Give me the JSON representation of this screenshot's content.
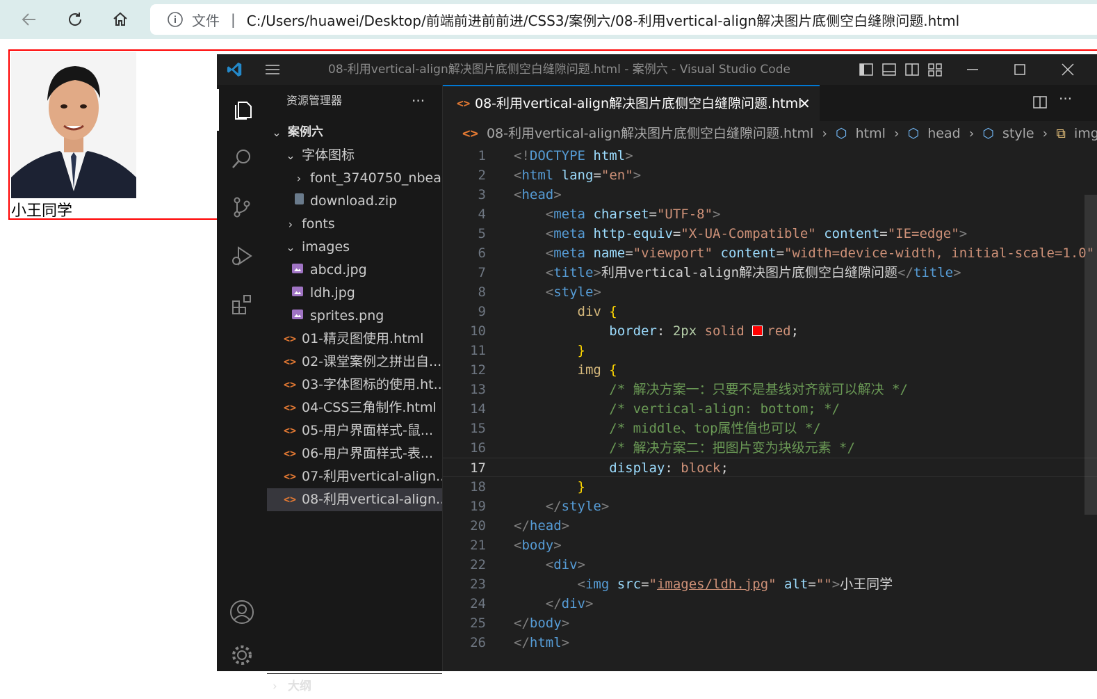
{
  "browser": {
    "file_label": "文件",
    "separator": "|",
    "url": "C:/Users/huawei/Desktop/前端前进前前进/CSS3/案例六/08-利用vertical-align解决图片底侧空白缝隙问题.html"
  },
  "page": {
    "caption": "小王同学",
    "border_color": "#ff0000"
  },
  "vscode": {
    "window_title": "08-利用vertical-align解决图片底侧空白缝隙问题.html - 案例六 - Visual Studio Code",
    "explorer": {
      "title": "资源管理器",
      "more": "···",
      "root": "案例六",
      "items": [
        {
          "label": "字体图标"
        },
        {
          "label": "font_3740750_nbea..."
        },
        {
          "label": "download.zip"
        },
        {
          "label": "fonts"
        },
        {
          "label": "images"
        },
        {
          "label": "abcd.jpg"
        },
        {
          "label": "ldh.jpg"
        },
        {
          "label": "sprites.png"
        },
        {
          "label": "01-精灵图使用.html"
        },
        {
          "label": "02-课堂案例之拼出自..."
        },
        {
          "label": "03-字体图标的使用.ht..."
        },
        {
          "label": "04-CSS三角制作.html"
        },
        {
          "label": "05-用户界面样式-鼠..."
        },
        {
          "label": "06-用户界面样式-表..."
        },
        {
          "label": "07-利用vertical-align..."
        },
        {
          "label": "08-利用vertical-align..."
        }
      ],
      "outline": "大纲"
    },
    "tab": {
      "label": "08-利用vertical-align解决图片底侧空白缝隙问题.html",
      "close": "✕"
    },
    "breadcrumb": {
      "file": "08-利用vertical-align解决图片底侧空白缝隙问题.html",
      "html": "html",
      "head": "head",
      "style": "style",
      "img": "img"
    },
    "code": {
      "line_numbers": [
        "1",
        "2",
        "3",
        "4",
        "5",
        "6",
        "7",
        "8",
        "9",
        "10",
        "11",
        "12",
        "13",
        "14",
        "15",
        "16",
        "17",
        "18",
        "19",
        "20",
        "21",
        "22",
        "23",
        "24",
        "25",
        "26"
      ],
      "current_line": "17",
      "lines": {
        "l1_tag": "DOCTYPE",
        "l1_attr": "html",
        "l2_tag": "html",
        "l2_attr": "lang",
        "l2_val": "\"en\"",
        "l3_tag": "head",
        "l4_tag": "meta",
        "l4_attr": "charset",
        "l4_val": "\"UTF-8\"",
        "l5_tag": "meta",
        "l5_attr1": "http-equiv",
        "l5_val1": "\"X-UA-Compatible\"",
        "l5_attr2": "content",
        "l5_val2": "\"IE=edge\"",
        "l6_tag": "meta",
        "l6_attr1": "name",
        "l6_val1": "\"viewport\"",
        "l6_attr2": "content",
        "l6_val2": "\"width=device-width, initial-scale=1.0\"",
        "l7_tag": "title",
        "l7_text": "利用vertical-align解决图片底侧空白缝隙问题",
        "l8_tag": "style",
        "l9_sel": "div",
        "l10_prop": "border",
        "l10_num": "2px",
        "l10_val1": "solid",
        "l10_val2": "red",
        "l12_sel": "img",
        "l13_cmt": "/* 解决方案一：只要不是基线对齐就可以解决 */",
        "l14_cmt": "/* vertical-align: bottom; */",
        "l15_cmt": "/* middle、top属性值也可以 */",
        "l16_cmt": "/* 解决方案二：把图片变为块级元素 */",
        "l17_prop": "display",
        "l17_val": "block",
        "l19_tag": "style",
        "l20_tag": "head",
        "l21_tag": "body",
        "l22_tag": "div",
        "l23_tag": "img",
        "l23_attr1": "src",
        "l23_val1": "images/ldh.jpg",
        "l23_attr2": "alt",
        "l23_val2": "\"\"",
        "l23_text": "小王同学",
        "l24_tag": "div",
        "l25_tag": "body",
        "l26_tag": "html"
      }
    }
  }
}
